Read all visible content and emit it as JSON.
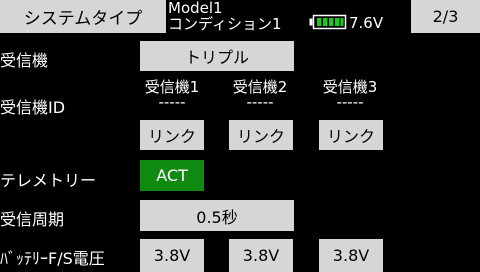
{
  "header": {
    "title": "システムタイプ",
    "model": "Model1",
    "condition": "コンディション1",
    "battery_voltage": "7.6V",
    "page": "2/3",
    "battery_color": "#1ec81e",
    "battery_icon": "battery-icon"
  },
  "receiver": {
    "label": "受信機",
    "value": "トリプル"
  },
  "receiver_id": {
    "label": "受信機ID",
    "columns": [
      {
        "name": "受信機1",
        "id": "-----",
        "link_label": "リンク"
      },
      {
        "name": "受信機2",
        "id": "-----",
        "link_label": "リンク"
      },
      {
        "name": "受信機3",
        "id": "-----",
        "link_label": "リンク"
      }
    ]
  },
  "telemetry": {
    "label": "テレメトリー",
    "value": "ACT",
    "active_color": "#108a10"
  },
  "receive_period": {
    "label": "受信周期",
    "value": "0.5秒"
  },
  "battery_fs": {
    "label": "ﾊﾞｯﾃﾘｰF/S電圧",
    "values": [
      "3.8V",
      "3.8V",
      "3.8V"
    ]
  }
}
